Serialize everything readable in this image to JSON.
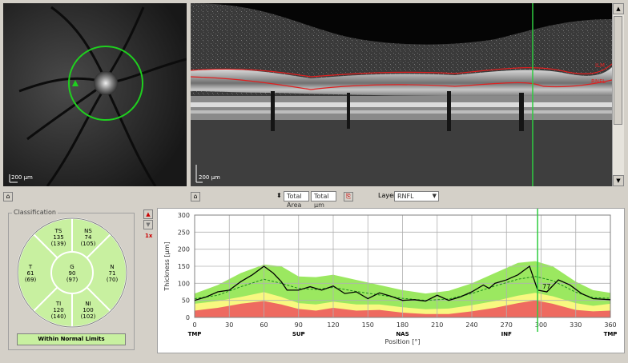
{
  "fundus": {
    "scale_label": "200 µm"
  },
  "bscan": {
    "layer_labels": [
      "ILM",
      "RNFL"
    ],
    "scale_label": "200 µm"
  },
  "toolbar": {
    "field_left": "Total Area",
    "field_right": "Total µm",
    "layer_label": "Layer",
    "layer_value": "RNFL"
  },
  "classification": {
    "title": "Classification",
    "sectors": [
      {
        "id": "TS",
        "value": "135",
        "normative": "(139)"
      },
      {
        "id": "NS",
        "value": "74",
        "normative": "(105)"
      },
      {
        "id": "T",
        "value": "61",
        "normative": "(69)"
      },
      {
        "id": "G",
        "value": "90",
        "normative": "(97)"
      },
      {
        "id": "N",
        "value": "71",
        "normative": "(70)"
      },
      {
        "id": "TI",
        "value": "120",
        "normative": "(140)"
      },
      {
        "id": "NI",
        "value": "100",
        "normative": "(102)"
      }
    ],
    "status": "Within Normal Limits",
    "colors": {
      "normal": "#c8f0a0",
      "line": "#ffffff"
    }
  },
  "side_buttons": {
    "zoom_label": "1x"
  },
  "chart_data": {
    "type": "line",
    "title": "",
    "ylabel": "Thickness [µm]",
    "xlabel": "Position [°]",
    "xlim": [
      0,
      360
    ],
    "ylim": [
      0,
      300
    ],
    "x_ticks": [
      0,
      30,
      60,
      90,
      120,
      150,
      180,
      210,
      240,
      270,
      300,
      330,
      360
    ],
    "y_ticks": [
      0,
      50,
      100,
      150,
      200,
      250,
      300
    ],
    "x_tick_labels_shown": [
      "0",
      "30",
      "60",
      "90",
      "120",
      "150",
      "180",
      "210",
      "240",
      "270",
      "300",
      "330",
      "360"
    ],
    "y_tick_labels_shown": [
      "0",
      "50",
      "100",
      "150",
      "200",
      "250",
      "300"
    ],
    "region_labels": [
      {
        "label": "TMP",
        "x": 0
      },
      {
        "label": "SUP",
        "x": 90
      },
      {
        "label": "NAS",
        "x": 180
      },
      {
        "label": "INF",
        "x": 270
      },
      {
        "label": "TMP",
        "x": 360
      }
    ],
    "marker": {
      "x": 297,
      "label": "77"
    },
    "colors": {
      "outside": "#ee6a60",
      "borderline": "#f8f880",
      "normal": "#9be860",
      "measured": "#000000",
      "normative": "#1a8a1a",
      "marker": "#2ecc40"
    },
    "band_x": [
      0,
      20,
      40,
      60,
      75,
      90,
      105,
      120,
      140,
      160,
      180,
      200,
      220,
      240,
      260,
      280,
      295,
      310,
      330,
      345,
      360
    ],
    "band_outside": [
      20,
      28,
      40,
      48,
      38,
      25,
      20,
      28,
      20,
      22,
      14,
      10,
      10,
      18,
      28,
      42,
      50,
      40,
      22,
      18,
      20
    ],
    "band_borderline": [
      40,
      48,
      60,
      74,
      60,
      42,
      38,
      46,
      38,
      38,
      30,
      24,
      26,
      36,
      48,
      64,
      72,
      62,
      42,
      34,
      40
    ],
    "band_normal_upper": [
      70,
      95,
      130,
      155,
      150,
      120,
      118,
      125,
      110,
      95,
      80,
      70,
      78,
      100,
      130,
      160,
      165,
      150,
      105,
      80,
      72
    ],
    "normative_mean": [
      55,
      65,
      90,
      112,
      100,
      85,
      82,
      88,
      76,
      66,
      56,
      50,
      54,
      70,
      92,
      112,
      120,
      108,
      74,
      58,
      56
    ],
    "measured_x": [
      0,
      10,
      20,
      30,
      40,
      50,
      60,
      68,
      75,
      80,
      90,
      100,
      110,
      120,
      130,
      140,
      150,
      160,
      170,
      180,
      190,
      200,
      210,
      220,
      230,
      240,
      250,
      255,
      260,
      270,
      280,
      290,
      297,
      305,
      315,
      325,
      335,
      345,
      360
    ],
    "measured": [
      50,
      60,
      75,
      80,
      105,
      125,
      150,
      130,
      105,
      80,
      80,
      90,
      80,
      92,
      70,
      75,
      55,
      72,
      62,
      50,
      52,
      48,
      65,
      50,
      60,
      75,
      95,
      85,
      100,
      110,
      125,
      150,
      80,
      75,
      110,
      95,
      70,
      55,
      52
    ]
  }
}
